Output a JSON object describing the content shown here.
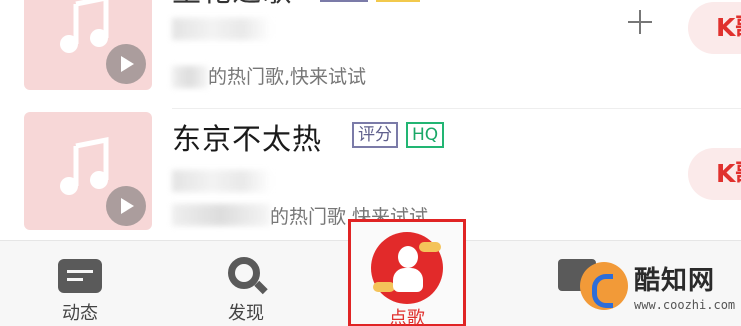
{
  "songs": [
    {
      "title": "生花之歌",
      "tag_score": "",
      "tag_hq": "",
      "desc": "的热门歌,快来试试",
      "k_label": "K歌",
      "add_symbol": "+"
    },
    {
      "title": "东京不太热",
      "tag_score": "评分",
      "tag_hq": "HQ",
      "desc": "的热门歌 快来试试",
      "k_label": "K歌"
    }
  ],
  "tabbar": {
    "tabs": [
      {
        "label": "动态",
        "icon": "message-icon"
      },
      {
        "label": "发现",
        "icon": "search-icon"
      },
      {
        "label": "点歌",
        "icon": "song-request-icon",
        "selected": true
      },
      {
        "label": "",
        "icon": "mail-icon"
      }
    ]
  },
  "watermark": {
    "title": "酷知网",
    "url": "www.coozhi.com"
  },
  "colors": {
    "accent": "#e0312e",
    "hq_tag": "#22b573",
    "score_tag": "#7b7ba8",
    "highlight_box": "#e02424"
  }
}
